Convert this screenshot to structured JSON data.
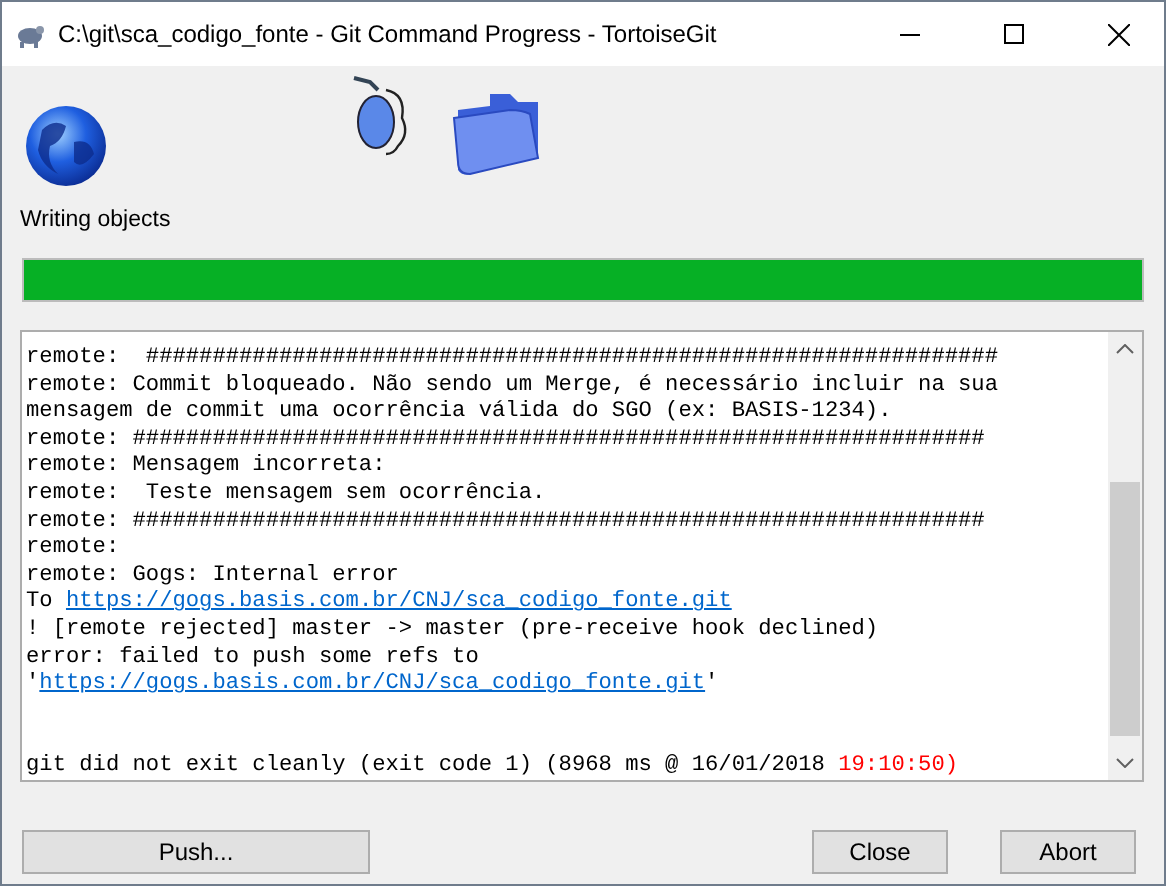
{
  "window": {
    "title": "C:\\git\\sca_codigo_fonte - Git Command Progress - TortoiseGit"
  },
  "status": {
    "text": "Writing objects"
  },
  "progress": {
    "level": 1.0
  },
  "log": [
    {
      "kind": "text",
      "segments": [
        {
          "kind": "plain",
          "text": "remote:  ################################################################"
        }
      ]
    },
    {
      "kind": "text",
      "segments": [
        {
          "kind": "plain",
          "text": "remote: Commit bloqueado. Não sendo um Merge, é necessário incluir na sua"
        }
      ]
    },
    {
      "kind": "text",
      "segments": [
        {
          "kind": "plain",
          "text": "mensagem de commit uma ocorrência válida do SGO (ex: BASIS-1234)."
        }
      ]
    },
    {
      "kind": "text",
      "segments": [
        {
          "kind": "plain",
          "text": "remote: ################################################################"
        }
      ]
    },
    {
      "kind": "text",
      "segments": [
        {
          "kind": "plain",
          "text": "remote: Mensagem incorreta:"
        }
      ]
    },
    {
      "kind": "text",
      "segments": [
        {
          "kind": "plain",
          "text": "remote:  Teste mensagem sem ocorrência."
        }
      ]
    },
    {
      "kind": "text",
      "segments": [
        {
          "kind": "plain",
          "text": "remote: ################################################################"
        }
      ]
    },
    {
      "kind": "text",
      "segments": [
        {
          "kind": "plain",
          "text": "remote:"
        }
      ]
    },
    {
      "kind": "text",
      "segments": [
        {
          "kind": "plain",
          "text": "remote: Gogs: Internal error"
        }
      ]
    },
    {
      "kind": "text",
      "segments": [
        {
          "kind": "plain",
          "text": "To "
        },
        {
          "kind": "link",
          "text": "https://gogs.basis.com.br/CNJ/sca_codigo_fonte.git"
        }
      ]
    },
    {
      "kind": "text",
      "segments": [
        {
          "kind": "plain",
          "text": "! [remote rejected] master -> master (pre-receive hook declined)"
        }
      ]
    },
    {
      "kind": "text",
      "segments": [
        {
          "kind": "plain",
          "text": "error: failed to push some refs to"
        }
      ]
    },
    {
      "kind": "text",
      "segments": [
        {
          "kind": "plain",
          "text": "'"
        },
        {
          "kind": "link",
          "text": "https://gogs.basis.com.br/CNJ/sca_codigo_fonte.git"
        },
        {
          "kind": "plain",
          "text": "'"
        }
      ]
    },
    {
      "kind": "blank"
    },
    {
      "kind": "blank"
    },
    {
      "kind": "text",
      "segments": [
        {
          "kind": "plain",
          "text": "git did not exit cleanly (exit code 1) (8968 ms @ 16/01/2018 "
        },
        {
          "kind": "time",
          "text": "19:10:50)"
        }
      ]
    }
  ],
  "buttons": [
    {
      "label": "Push..."
    },
    {
      "label": "Close"
    },
    {
      "label": "Abort"
    }
  ]
}
